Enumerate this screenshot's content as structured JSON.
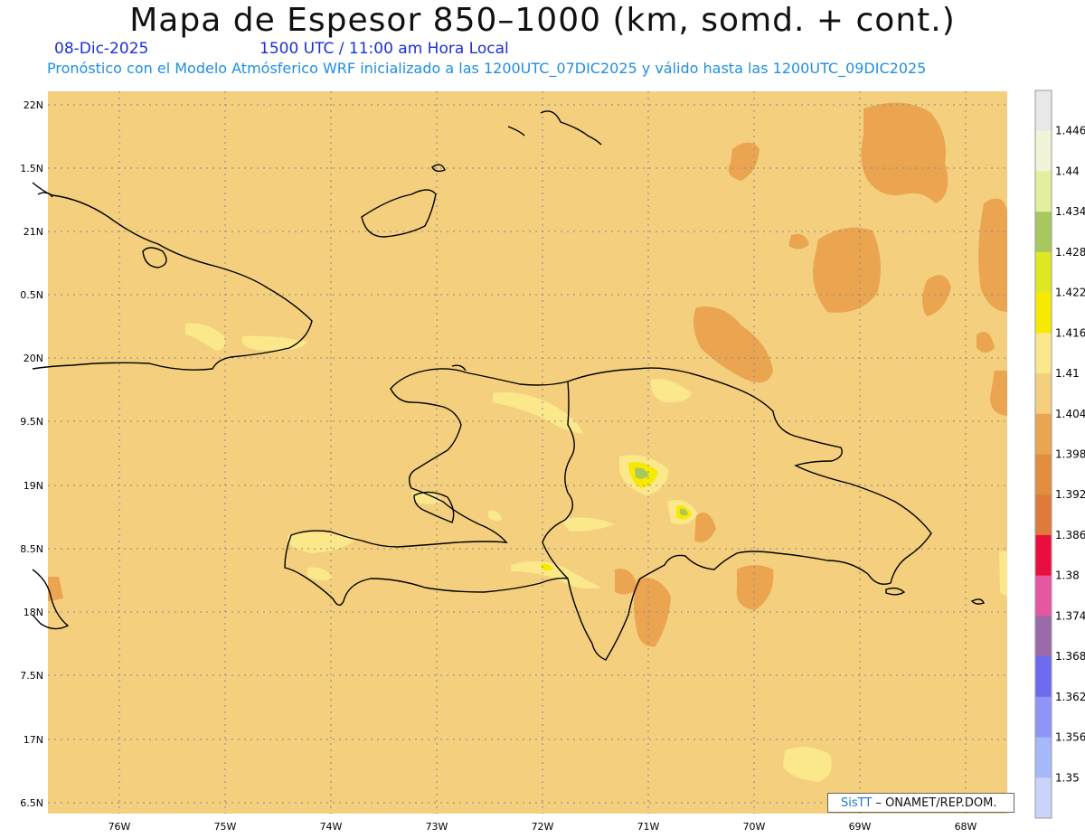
{
  "header": {
    "title": "Mapa de Espesor 850–1000 (km, somd. + cont.)",
    "date": "08-Dic-2025",
    "time": "1500 UTC / 11:00 am Hora Local",
    "forecast": "Pronóstico con el Modelo Atmósferico WRF inicializado a las 1200UTC_07DIC2025 y válido hasta las  1200UTC_09DIC2025"
  },
  "axes": {
    "lat_labels": [
      "22N",
      "1.5N",
      "21N",
      "0.5N",
      "20N",
      "9.5N",
      "19N",
      "8.5N",
      "18N",
      "7.5N",
      "17N",
      "6.5N"
    ],
    "lon_labels": [
      "76W",
      "75W",
      "74W",
      "73W",
      "72W",
      "71W",
      "70W",
      "69W",
      "68W"
    ]
  },
  "legend": {
    "labels": [
      "1.446",
      "1.44",
      "1.434",
      "1.428",
      "1.422",
      "1.416",
      "1.41",
      "1.404",
      "1.398",
      "1.392",
      "1.386",
      "1.38",
      "1.374",
      "1.368",
      "1.362",
      "1.356",
      "1.35"
    ],
    "colors": [
      "#e8e8e8",
      "#f1f4d6",
      "#e3ef9c",
      "#a8c85e",
      "#dfe923",
      "#f7ea00",
      "#fbe88a",
      "#f3cf7e",
      "#eba550",
      "#e38e3f",
      "#df7a3a",
      "#ea0e3e",
      "#e756a2",
      "#9a6aa9",
      "#6d6bf2",
      "#8e95f8",
      "#a5b9fa",
      "#c9d3fb"
    ]
  },
  "colors": {
    "background_field": "#f3cf7e",
    "coastline": "#000000"
  },
  "footer": {
    "brand": "SisTT",
    "org": "– ONAMET/REP.DOM."
  }
}
